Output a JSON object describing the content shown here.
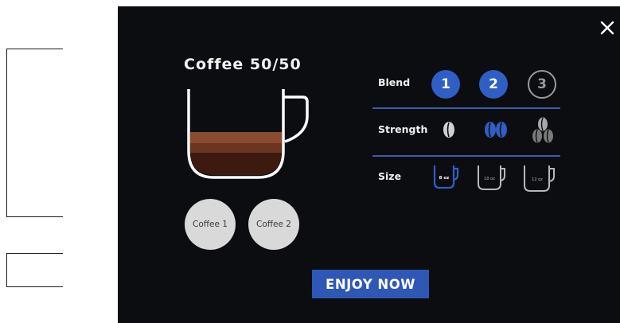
{
  "title": "Coffee 50/50",
  "choices": [
    {
      "label": "Coffee 1"
    },
    {
      "label": "Coffee 2"
    }
  ],
  "rows": {
    "blend": {
      "label": "Blend",
      "options": [
        "1",
        "2",
        "3"
      ],
      "selected": [
        "1",
        "2"
      ]
    },
    "strength": {
      "label": "Strength",
      "options": [
        "single-bean-icon",
        "double-bean-icon",
        "triple-bean-icon"
      ],
      "selected": "double-bean-icon"
    },
    "size": {
      "label": "Size",
      "options": [
        "8 oz",
        "10 oz",
        "12 oz"
      ],
      "selected": "8 oz"
    }
  },
  "action": {
    "label": "ENJOY NOW"
  },
  "colors": {
    "panel": "#0c0d10",
    "accent": "#2f5fc4",
    "coffee_light": "#8a4b33",
    "coffee_dark": "#3c1a10"
  }
}
